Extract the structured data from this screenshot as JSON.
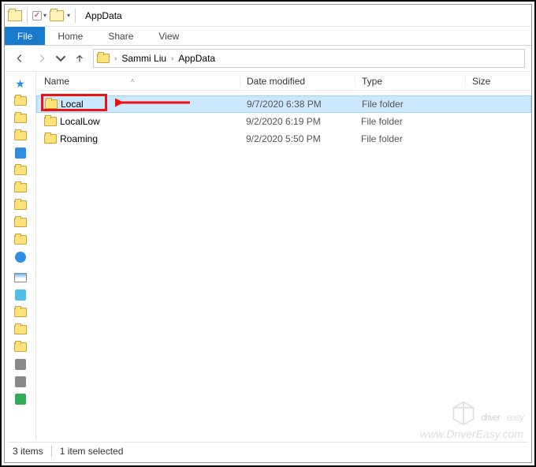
{
  "window": {
    "title": "AppData"
  },
  "ribbon": {
    "file": "File",
    "tabs": [
      "Home",
      "Share",
      "View"
    ]
  },
  "breadcrumb": {
    "items": [
      "Sammi Liu",
      "AppData"
    ]
  },
  "columns": {
    "name": "Name",
    "date": "Date modified",
    "type": "Type",
    "size": "Size"
  },
  "items": [
    {
      "name": "Local",
      "date": "9/7/2020 6:38 PM",
      "type": "File folder",
      "selected": true
    },
    {
      "name": "LocalLow",
      "date": "9/2/2020 6:19 PM",
      "type": "File folder",
      "selected": false
    },
    {
      "name": "Roaming",
      "date": "9/2/2020 5:50 PM",
      "type": "File folder",
      "selected": false
    }
  ],
  "status": {
    "count": "3 items",
    "selected": "1 item selected"
  },
  "watermark": {
    "brand_a": "driver",
    "brand_b": "easy",
    "url": "www.DriverEasy.com"
  }
}
